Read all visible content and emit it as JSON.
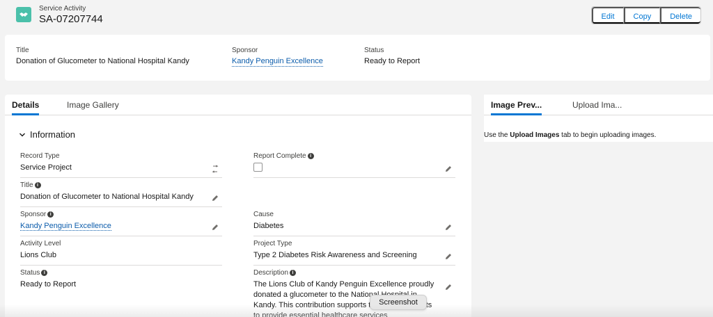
{
  "header": {
    "object_type": "Service Activity",
    "record_name": "SA-07207744",
    "actions": [
      "Edit",
      "Copy",
      "Delete"
    ]
  },
  "highlights": {
    "title_label": "Title",
    "title_value": "Donation of Glucometer to National Hospital Kandy",
    "sponsor_label": "Sponsor",
    "sponsor_value": "Kandy Penguin Excellence",
    "status_label": "Status",
    "status_value": "Ready to Report"
  },
  "tabs": {
    "details": "Details",
    "gallery": "Image Gallery"
  },
  "section": {
    "title": "Information"
  },
  "fields": {
    "record_type_label": "Record Type",
    "record_type_value": "Service Project",
    "report_complete_label": "Report Complete",
    "title_label": "Title",
    "title_value": "Donation of Glucometer to National Hospital Kandy",
    "sponsor_label": "Sponsor",
    "sponsor_value": "Kandy Penguin Excellence",
    "cause_label": "Cause",
    "cause_value": "Diabetes",
    "activity_level_label": "Activity Level",
    "activity_level_value": "Lions Club",
    "project_type_label": "Project Type",
    "project_type_value": "Type 2 Diabetes Risk Awareness and Screening",
    "status_label": "Status",
    "status_value": "Ready to Report",
    "description_label": "Description",
    "description_value": "The Lions Club of Kandy Penguin Excellence proudly donated a glucometer to the National Hospital in Kandy. This contribution supports the ongoing efforts to provide essential healthcare services"
  },
  "side": {
    "tab_preview": "Image Prev...",
    "tab_upload": "Upload Ima...",
    "text_before": "Use the ",
    "text_bold": "Upload Images",
    "text_after": " tab to begin uploading images."
  },
  "tooltip": "Screenshot",
  "colors": {
    "brand": "#0176d3",
    "icon_bg": "#4bc0aa",
    "link": "#0b5cab"
  }
}
